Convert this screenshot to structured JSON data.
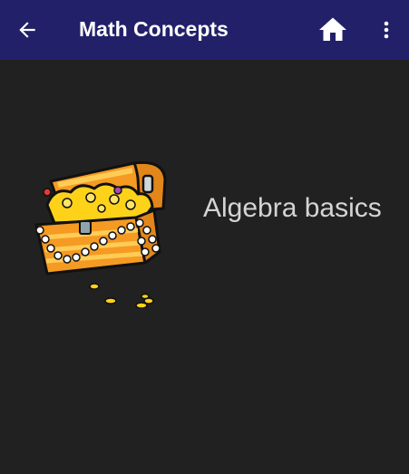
{
  "app_bar": {
    "title": "Math Concepts",
    "back_icon": "arrow-left-icon",
    "home_icon": "home-icon",
    "menu_icon": "more-vert-icon",
    "background_color": "#23206a"
  },
  "content": {
    "background_color": "#212121",
    "topics": [
      {
        "label": "Algebra basics",
        "image": "treasure-chest-image"
      }
    ]
  }
}
